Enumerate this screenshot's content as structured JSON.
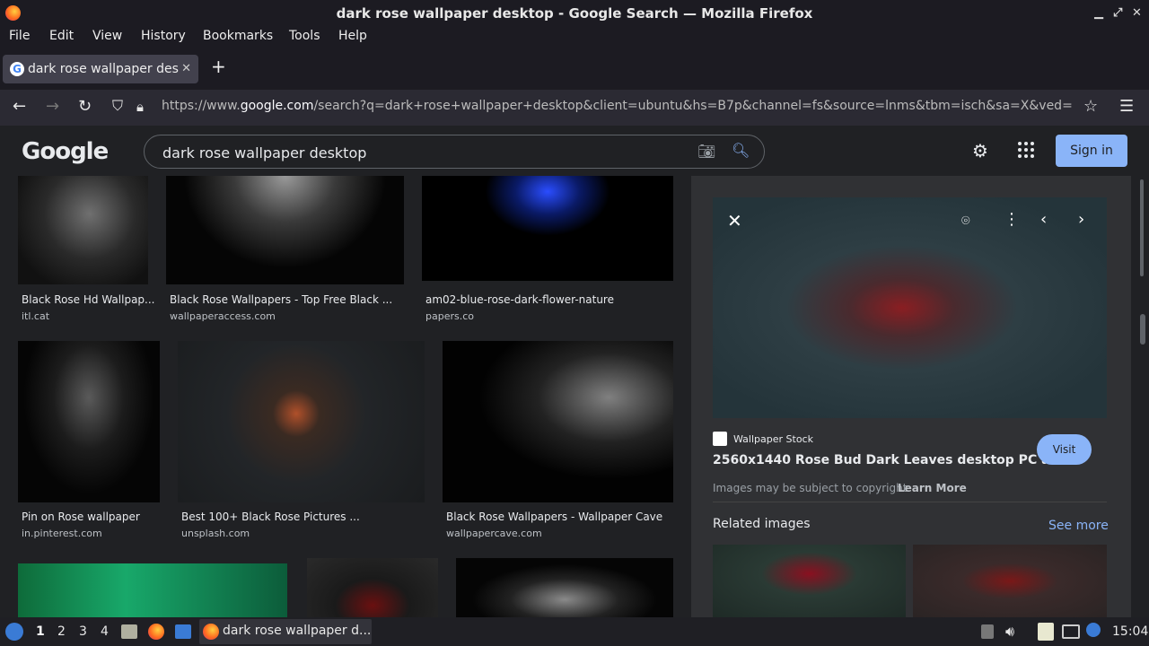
{
  "window": {
    "title": "dark rose wallpaper desktop - Google Search — Mozilla Firefox",
    "min": "▁",
    "max": "⤢",
    "close": "✕"
  },
  "menu": [
    "File",
    "Edit",
    "View",
    "History",
    "Bookmarks",
    "Tools",
    "Help"
  ],
  "tab": {
    "title": "dark rose wallpaper desktop",
    "close": "✕",
    "new": "+"
  },
  "nav": {
    "url_prefix": "https://www.",
    "url_domain": "google.com",
    "url_rest": "/search?q=dark+rose+wallpaper+desktop&client=ubuntu&hs=B7p&channel=fs&source=lnms&tbm=isch&sa=X&ved="
  },
  "google": {
    "logo": "Google",
    "query": "dark rose wallpaper desktop",
    "signin": "Sign in"
  },
  "results": [
    {
      "caption": "Black Rose Hd Wallpap...",
      "source": "itl.cat"
    },
    {
      "caption": "Black Rose Wallpapers - Top Free Black ...",
      "source": "wallpaperaccess.com"
    },
    {
      "caption": "am02-blue-rose-dark-flower-nature",
      "source": "papers.co"
    },
    {
      "caption": "Pin on Rose wallpaper",
      "source": "in.pinterest.com"
    },
    {
      "caption": "Best 100+ Black Rose Pictures ...",
      "source": "unsplash.com"
    },
    {
      "caption": "Black Rose Wallpapers - Wallpaper Cave",
      "source": "wallpapercave.com"
    }
  ],
  "preview": {
    "site": "Wallpaper Stock",
    "title": "2560x1440 Rose Bud Dark Leaves desktop PC and...",
    "visit": "Visit",
    "copyright": "Images may be subject to copyright.",
    "learn_more": "Learn More",
    "related": "Related images",
    "see_more": "See more"
  },
  "taskbar": {
    "workspaces": [
      "1",
      "2",
      "3",
      "4"
    ],
    "window": "dark rose wallpaper d...",
    "clock": "15:04"
  },
  "colors": {
    "accent": "#8ab4f8",
    "background": "#202124",
    "panel": "#303134"
  }
}
